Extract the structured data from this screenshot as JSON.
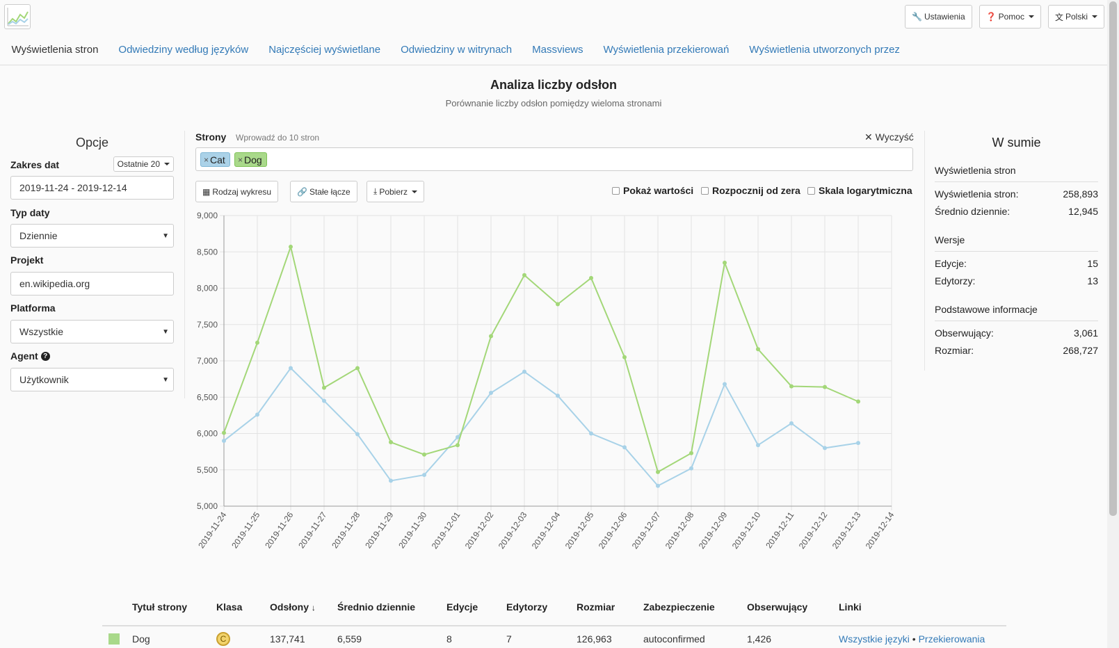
{
  "top": {
    "settings": "Ustawienia",
    "help": "Pomoc",
    "language": "Polski"
  },
  "nav": [
    "Wyświetlenia stron",
    "Odwiedziny według języków",
    "Najczęściej wyświetlane",
    "Odwiedziny w witrynach",
    "Massviews",
    "Wyświetlenia przekierowań",
    "Wyświetlenia utworzonych przez"
  ],
  "header": {
    "title": "Analiza liczby odsłon",
    "subtitle": "Porównanie liczby odsłon pomiędzy wieloma stronami"
  },
  "options": {
    "heading": "Opcje",
    "date_range_label": "Zakres dat",
    "date_preset": "Ostatnie 20",
    "date_range": "2019-11-24 - 2019-12-14",
    "date_type_label": "Typ daty",
    "date_type": "Dziennie",
    "project_label": "Projekt",
    "project": "en.wikipedia.org",
    "platform_label": "Platforma",
    "platform": "Wszystkie",
    "agent_label": "Agent",
    "agent": "Użytkownik"
  },
  "pages": {
    "label": "Strony",
    "hint": "Wprowadź do 10 stron",
    "clear": "Wyczyść",
    "tags": [
      {
        "name": "Cat",
        "color": "#abd2e8"
      },
      {
        "name": "Dog",
        "color": "#a9d98a"
      }
    ]
  },
  "toolbar": {
    "chart_type": "Rodzaj wykresu",
    "permalink": "Stałe łącze",
    "download": "Pobierz",
    "show_values": "Pokaż wartości",
    "begin_zero": "Rozpocznij od zera",
    "log_scale": "Skala logarytmiczna"
  },
  "chart_data": {
    "type": "line",
    "x": [
      "2019-11-24",
      "2019-11-25",
      "2019-11-26",
      "2019-11-27",
      "2019-11-28",
      "2019-11-29",
      "2019-11-30",
      "2019-12-01",
      "2019-12-02",
      "2019-12-03",
      "2019-12-04",
      "2019-12-05",
      "2019-12-06",
      "2019-12-07",
      "2019-12-08",
      "2019-12-09",
      "2019-12-10",
      "2019-12-11",
      "2019-12-12",
      "2019-12-13",
      "2019-12-14"
    ],
    "ylim": [
      5000,
      9000
    ],
    "yticks": [
      5000,
      5500,
      6000,
      6500,
      7000,
      7500,
      8000,
      8500,
      9000
    ],
    "grid": true,
    "series": [
      {
        "name": "Cat",
        "color": "#a8d2e8",
        "values": [
          5900,
          6260,
          6900,
          6450,
          5990,
          5350,
          5430,
          5950,
          6560,
          6850,
          6520,
          6000,
          5810,
          5280,
          5520,
          6680,
          5840,
          6140,
          5800,
          5870
        ]
      },
      {
        "name": "Dog",
        "color": "#a3d778",
        "values": [
          6010,
          7250,
          8570,
          6630,
          6900,
          5880,
          5710,
          5840,
          7340,
          8180,
          7780,
          8140,
          7050,
          5470,
          5730,
          8350,
          7160,
          6650,
          6640,
          6440
        ]
      }
    ]
  },
  "summary": {
    "heading": "W sumie",
    "pageviews_heading": "Wyświetlenia stron",
    "pageviews_label": "Wyświetlenia stron:",
    "pageviews_value": "258,893",
    "daily_label": "Średnio dziennie:",
    "daily_value": "12,945",
    "revisions_heading": "Wersje",
    "edits_label": "Edycje:",
    "edits_value": "15",
    "editors_label": "Edytorzy:",
    "editors_value": "13",
    "basic_heading": "Podstawowe informacje",
    "watchers_label": "Obserwujący:",
    "watchers_value": "3,061",
    "size_label": "Rozmiar:",
    "size_value": "268,727"
  },
  "table": {
    "headers": [
      "Tytuł strony",
      "Klasa",
      "Odsłony",
      "Średnio dziennie",
      "Edycje",
      "Edytorzy",
      "Rozmiar",
      "Zabezpieczenie",
      "Obserwujący",
      "Linki"
    ],
    "row": {
      "color": "#a9d98a",
      "title": "Dog",
      "class": "C",
      "views": "137,741",
      "daily": "6,559",
      "edits": "8",
      "editors": "7",
      "size": "126,963",
      "protection": "autoconfirmed",
      "watchers": "1,426",
      "link_all": "Wszystkie języki",
      "link_sep": "•",
      "link_redirects": "Przekierowania"
    }
  }
}
